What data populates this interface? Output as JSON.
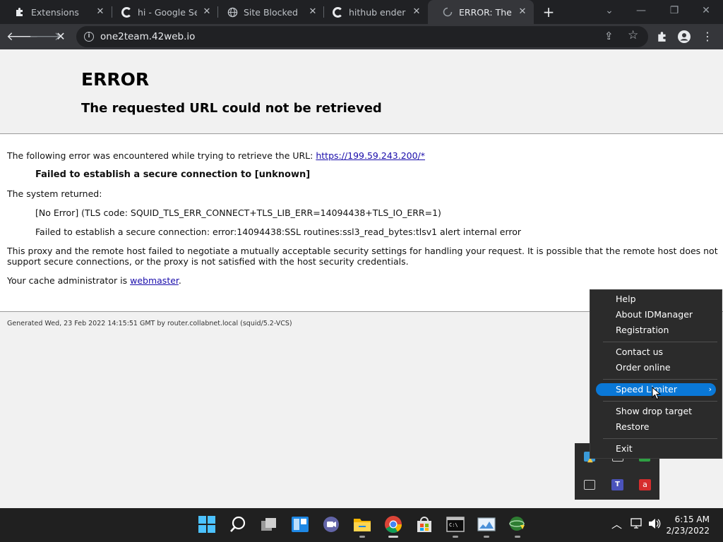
{
  "browser": {
    "tabs": [
      {
        "title": "Extensions",
        "icon": "puzzle-icon",
        "active": false
      },
      {
        "title": "hi - Google Search",
        "icon": "google-icon",
        "active": false
      },
      {
        "title": "Site Blocked",
        "icon": "globe-icon",
        "active": false
      },
      {
        "title": "hithub ender m",
        "icon": "google-icon",
        "active": false
      },
      {
        "title": "ERROR: The requested URL could not be retrieved",
        "icon": "loading-spinner-icon",
        "active": true
      }
    ],
    "new_tab_label": "+",
    "address": "one2team.42web.io"
  },
  "page": {
    "title": "ERROR",
    "subtitle": "The requested URL could not be retrieved",
    "encountered_prefix": "The following error was encountered while trying to retrieve the URL: ",
    "encountered_url": "https://199.59.243.200/*",
    "error_message": "Failed to establish a secure connection to [unknown]",
    "system_returned_label": "The system returned:",
    "system_detail_1": "[No Error] (TLS code: SQUID_TLS_ERR_CONNECT+TLS_LIB_ERR=14094438+TLS_IO_ERR=1)",
    "system_detail_2": "Failed to establish a secure connection: error:14094438:SSL routines:ssl3_read_bytes:tlsv1 alert internal error",
    "explanation_line1": "This proxy and the remote host failed to negotiate a mutually acceptable security settings for handling your request. It is possible that the remote host does not",
    "explanation_line2": "support secure connections, or the proxy is not satisfied with the host security credentials.",
    "cache_prefix": "Your cache administrator is ",
    "cache_link": "webmaster",
    "cache_suffix": ".",
    "footer": "Generated Wed, 23 Feb 2022 14:15:51 GMT by router.collabnet.local (squid/5.2-VCS)"
  },
  "context_menu": {
    "items": [
      {
        "label": "Help"
      },
      {
        "label": "About IDManager"
      },
      {
        "label": "Registration"
      },
      {
        "label": "Contact us"
      },
      {
        "label": "Order online"
      },
      {
        "label": "Speed Limiter",
        "submenu": true,
        "highlighted": true
      },
      {
        "label": "Show drop target"
      },
      {
        "label": "Restore"
      },
      {
        "label": "Exit"
      }
    ],
    "submenu_arrow": "›"
  },
  "taskbar": {
    "apps": [
      "start-icon",
      "search-icon",
      "task-view-icon",
      "widgets-icon",
      "chat-icon",
      "file-explorer-icon",
      "chrome-icon",
      "microsoft-store-icon",
      "terminal-icon",
      "image-viewer-icon",
      "idm-icon"
    ],
    "time": "6:15 AM",
    "date": "2/23/2022"
  },
  "colors": {
    "menu_highlight": "#0a78d7",
    "link": "#1a0dab",
    "taskbar_bg": "#202020"
  }
}
